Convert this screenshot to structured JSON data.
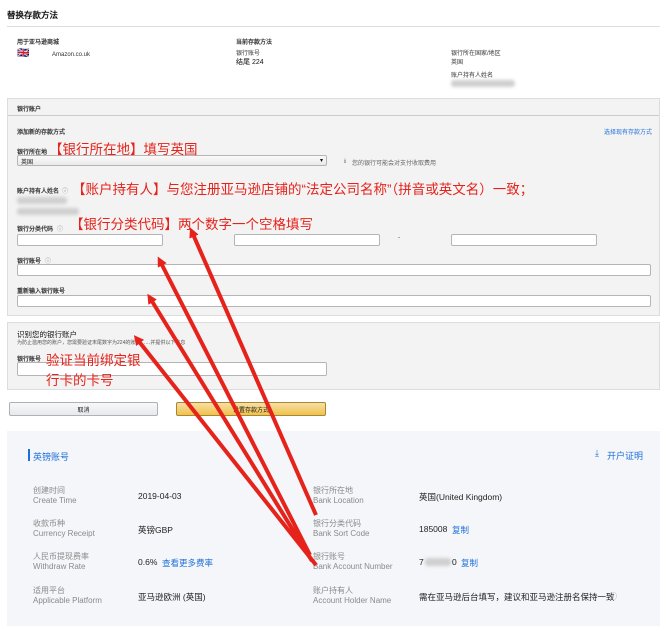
{
  "top": {
    "title": "替换存款方法",
    "marketplace_label": "用于亚马逊商城",
    "marketplace_value": "Amazon.co.uk",
    "current_method_label": "当前存款方法",
    "account_number_label": "银行账号",
    "account_number_value": "结尾 224",
    "country_label": "银行所在国家/地区",
    "country_value": "英国",
    "holder_label": "账户持有人姓名"
  },
  "bank": {
    "section_label": "银行账户",
    "add_method": "添加新的存款方式",
    "select_method_link": "选择现有存款方式",
    "location_label": "银行所在地",
    "location_value": "英国",
    "location_note": "您的银行可能会对支付收取费用",
    "holder_label": "账户持有人姓名",
    "sort_code_label": "银行分类代码",
    "sort_code_sep": "-",
    "account_label": "银行账号",
    "reenter_label": "重新输入银行账号",
    "verify_title": "识别您的银行账户",
    "verify_desc": "为防止滥用您的账户，您需要验证末尾数字为224的账户……并提供以下信息",
    "verify_field_label": "银行账号",
    "cancel": "取消",
    "submit": "设置存款方式"
  },
  "annotations": {
    "a1": "【银行所在地】填写英国",
    "a2": "【账户持有人】与您注册亚马逊店铺的“法定公司名称”（拼音或英文名）一致；",
    "a3": "【银行分类代码】两个数字一个空格填写",
    "a4": "验证当前绑定银",
    "a5": "行卡的卡号"
  },
  "gbp": {
    "title": "英镑账号",
    "proof_link": "开户证明",
    "create_time_cn": "创建时间",
    "create_time_en": "Create Time",
    "create_time_value": "2019-04-03",
    "currency_cn": "收款币种",
    "currency_en": "Currency Receipt",
    "currency_value": "英镑GBP",
    "fee_cn": "人民币提现费率",
    "fee_en": "Withdraw Rate",
    "fee_value": "0.6%",
    "fee_link": "查看更多费率",
    "platform_cn": "适用平台",
    "platform_en": "Applicable Platform",
    "platform_value": "亚马逊欧洲 (英国)",
    "location_cn": "银行所在地",
    "location_en": "Bank Location",
    "location_value": "英国(United Kingdom)",
    "sort_cn": "银行分类代码",
    "sort_en": "Bank Sort Code",
    "sort_value": "185008",
    "copy1": "复制",
    "acct_cn": "银行账号",
    "acct_en": "Bank Account Number",
    "acct_prefix": "7",
    "acct_suffix": "0",
    "copy2": "复制",
    "holder_cn": "账户持有人",
    "holder_en": "Account Holder Name",
    "holder_value": "需在亚马逊后台填写，建议和亚马逊注册名保持一致"
  },
  "colors": {
    "accent_red": "#e5231b",
    "link_blue": "#1e6fd9",
    "submit_yellow": "#f0c14b"
  }
}
